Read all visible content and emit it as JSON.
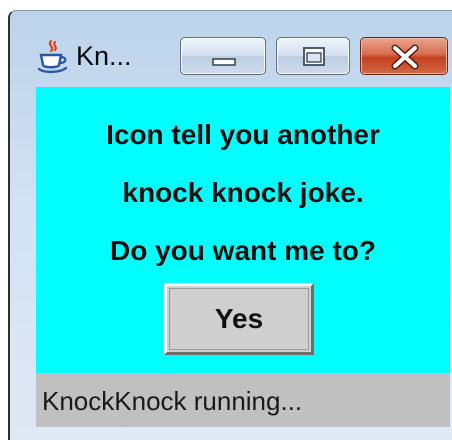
{
  "window": {
    "title": "Kn...",
    "app_icon": "java-cup-icon",
    "controls": {
      "minimize": "minimize-icon",
      "maximize": "maximize-icon",
      "close": "close-icon"
    }
  },
  "dialog": {
    "lines": [
      "Icon tell you another",
      "knock knock joke.",
      "Do you want me to?"
    ],
    "yes_button_label": "Yes",
    "background_color": "#00ffff"
  },
  "status_bar": {
    "text": "KnockKnock running..."
  }
}
